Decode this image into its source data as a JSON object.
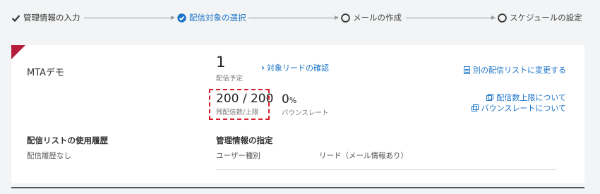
{
  "stepper": {
    "steps": [
      {
        "label": "管理情報の入力",
        "state": "done"
      },
      {
        "label": "配信対象の選択",
        "state": "active"
      },
      {
        "label": "メールの作成",
        "state": "todo"
      },
      {
        "label": "スケジュールの設定",
        "state": "todo"
      }
    ]
  },
  "card": {
    "name": "MTAデモ",
    "planned_count": "1",
    "planned_label": "配信予定",
    "check_leads_link": "対象リードの確認",
    "change_list_link": "別の配信リストに変更する",
    "remaining": "200 / 200",
    "remaining_label": "残配信数/上限",
    "bounce_value": "0",
    "bounce_unit": "%",
    "bounce_label": "バウンスレート",
    "limit_about_link": "配信数上限について",
    "bounce_about_link": "バウンスレートについて",
    "history_title": "配信リストの使用履歴",
    "history_value": "配信履歴なし",
    "mgmt_title": "管理情報の指定",
    "mgmt_key": "ユーザー種別",
    "mgmt_value": "リード（メール情報あり）"
  },
  "colors": {
    "accent": "#1a73c8",
    "highlight": "#d81e2a",
    "corner": "#b41e3c"
  }
}
